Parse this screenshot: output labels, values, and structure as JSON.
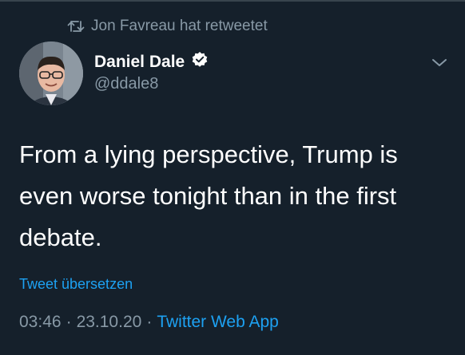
{
  "retweet_context": {
    "icon": "retweet-icon",
    "text": "Jon Favreau hat retweetet"
  },
  "author": {
    "name": "Daniel Dale",
    "handle": "@ddale8",
    "verified_icon": "verified-badge-icon"
  },
  "menu": {
    "icon": "chevron-down-icon"
  },
  "tweet": {
    "text": "From a lying perspective, Trump is even worse tonight than in the first debate."
  },
  "translate_label": "Tweet übersetzen",
  "meta": {
    "time": "03:46",
    "separator": "·",
    "date": "23.10.20",
    "source": "Twitter Web App"
  },
  "colors": {
    "background": "#15202b",
    "secondary_text": "#8899a6",
    "link": "#1da1f2"
  }
}
